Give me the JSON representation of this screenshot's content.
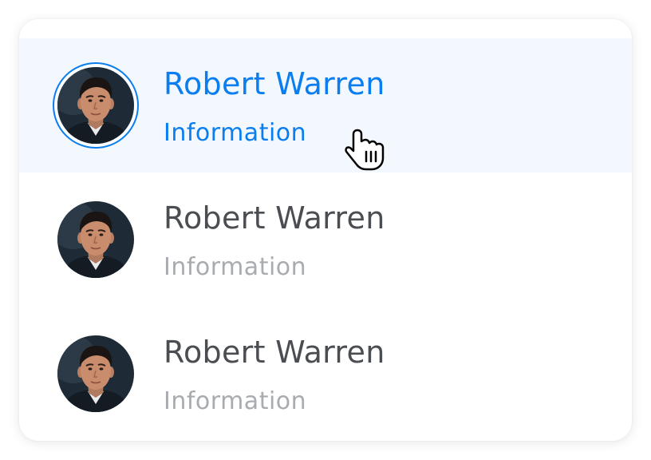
{
  "contacts": [
    {
      "name": "Robert Warren",
      "subtitle": "Information",
      "active": true
    },
    {
      "name": "Robert Warren",
      "subtitle": "Information",
      "active": false
    },
    {
      "name": "Robert Warren",
      "subtitle": "Information",
      "active": false
    }
  ],
  "colors": {
    "accent": "#0a7ef0",
    "active_row_bg": "#f2f8fe",
    "name_text": "#4a4d52",
    "subtitle_text": "#a8abb0"
  },
  "icons": {
    "avatar": "avatar-photo",
    "cursor": "hand-pointer-icon"
  }
}
